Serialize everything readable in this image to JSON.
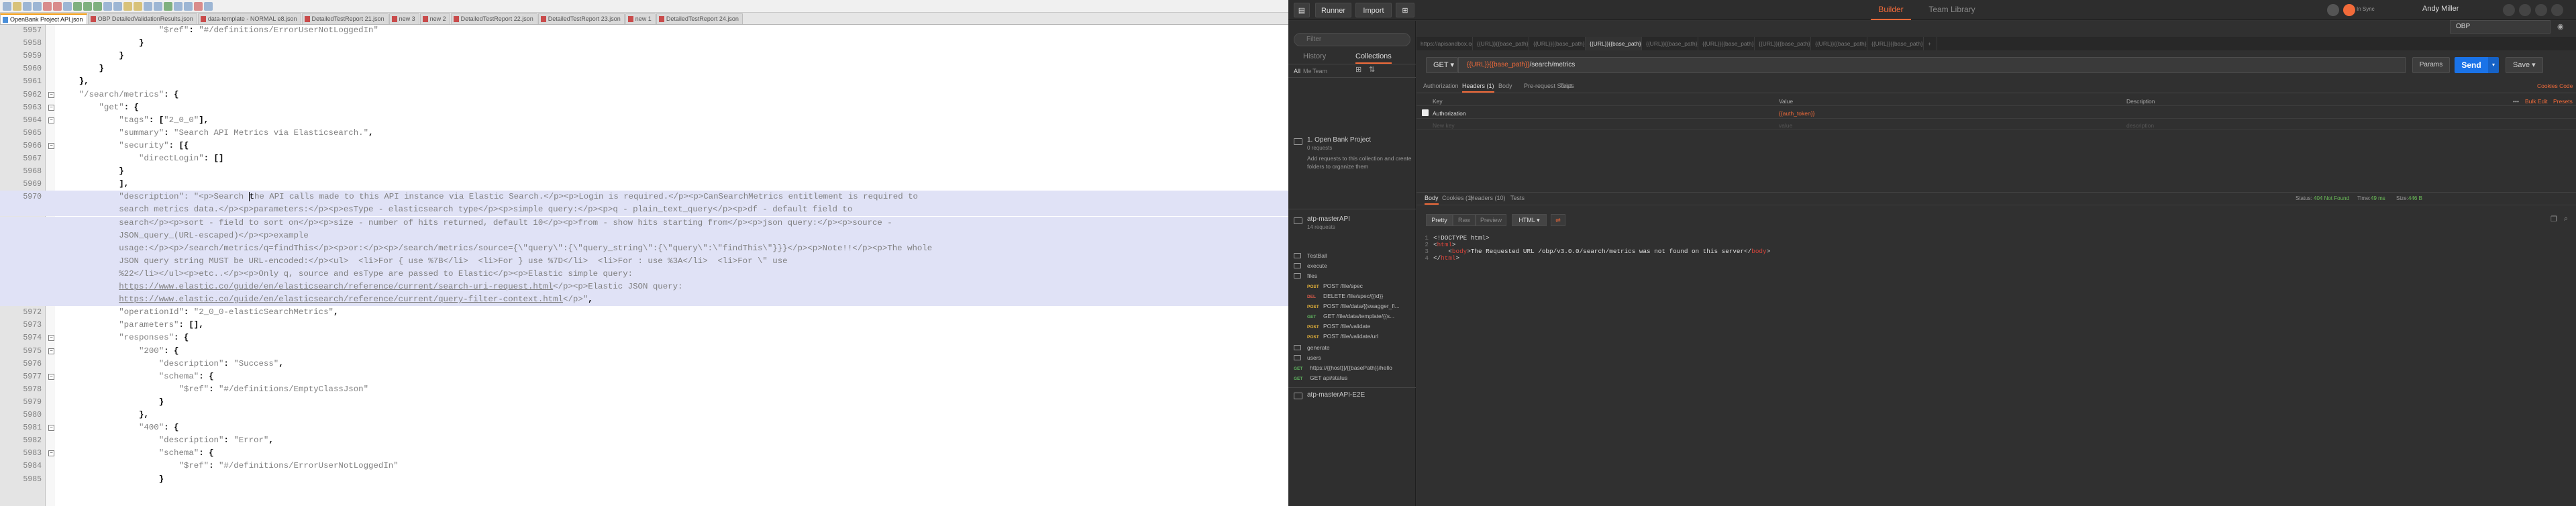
{
  "notepad": {
    "tabs": [
      "OpenBank Project API.json",
      "OBP DetailedValidationResults.json",
      "data-template - NORMAL e8.json",
      "DetailedTestReport 21.json",
      "new 3",
      "new 2",
      "DetailedTestReport 22.json",
      "DetailedTestReport 23.json",
      "new 1",
      "DetailedTestReport 24.json"
    ],
    "lines": [
      {
        "n": "5957",
        "t": [
          {
            "c": "",
            "v": "                    "
          },
          {
            "c": "s",
            "v": "\"$ref\""
          },
          {
            "c": "p",
            "v": ": "
          },
          {
            "c": "s",
            "v": "\"#/definitions/ErrorUserNotLoggedIn\""
          }
        ]
      },
      {
        "n": "5958",
        "t": [
          {
            "c": "p",
            "v": "                }"
          }
        ]
      },
      {
        "n": "5959",
        "t": [
          {
            "c": "p",
            "v": "            }"
          }
        ]
      },
      {
        "n": "5960",
        "t": [
          {
            "c": "p",
            "v": "        }"
          }
        ]
      },
      {
        "n": "5961",
        "t": [
          {
            "c": "p",
            "v": "    },"
          }
        ]
      },
      {
        "n": "5962",
        "fold": "-",
        "t": [
          {
            "c": "",
            "v": "    "
          },
          {
            "c": "s",
            "v": "\"/search/metrics\""
          },
          {
            "c": "p",
            "v": ": {"
          }
        ]
      },
      {
        "n": "5963",
        "fold": "-",
        "t": [
          {
            "c": "",
            "v": "        "
          },
          {
            "c": "s",
            "v": "\"get\""
          },
          {
            "c": "p",
            "v": ": {"
          }
        ]
      },
      {
        "n": "5964",
        "fold": "-",
        "t": [
          {
            "c": "",
            "v": "            "
          },
          {
            "c": "s",
            "v": "\"tags\""
          },
          {
            "c": "p",
            "v": ": ["
          },
          {
            "c": "s",
            "v": "\"2_0_0\""
          },
          {
            "c": "p",
            "v": "],"
          }
        ]
      },
      {
        "n": "5965",
        "t": [
          {
            "c": "",
            "v": "            "
          },
          {
            "c": "s",
            "v": "\"summary\""
          },
          {
            "c": "p",
            "v": ": "
          },
          {
            "c": "s",
            "v": "\"Search API Metrics via Elasticsearch.\""
          },
          {
            "c": "p",
            "v": ","
          }
        ]
      },
      {
        "n": "5966",
        "fold": "-",
        "t": [
          {
            "c": "",
            "v": "            "
          },
          {
            "c": "s",
            "v": "\"security\""
          },
          {
            "c": "p",
            "v": ": [{"
          }
        ]
      },
      {
        "n": "5967",
        "t": [
          {
            "c": "",
            "v": "                "
          },
          {
            "c": "s",
            "v": "\"directLogin\""
          },
          {
            "c": "p",
            "v": ": []"
          }
        ]
      },
      {
        "n": "5968",
        "t": [
          {
            "c": "p",
            "v": "            }"
          }
        ]
      },
      {
        "n": "5969",
        "t": [
          {
            "c": "p",
            "v": "            ],"
          }
        ]
      },
      {
        "n": "5970",
        "sel": true,
        "t": [
          {
            "c": "",
            "v": "            "
          },
          {
            "c": "s",
            "v": "\"description\": \"<p>Search "
          },
          {
            "c": "caret",
            "v": "t"
          },
          {
            "c": "s",
            "v": "he API calls made to this API instance via Elastic Search.</p><p>Login is required.</p><p>CanSearchMetrics entitlement is required to"
          }
        ]
      },
      {
        "n": "",
        "sel": true,
        "t": [
          {
            "c": "s",
            "v": "            search metrics data.</p><p>parameters:</p><p>esType - elasticsearch type</p><p>simple query:</p><p>q - plain_text_query</p><p>df - default field to"
          }
        ]
      },
      {
        "n": "",
        "sel": true,
        "t": [
          {
            "c": "s",
            "v": "            search</p><p>sort - field to sort on</p><p>size - number of hits returned, default 10</p><p>from - show hits starting from</p><p>json query:</p><p>source -"
          }
        ]
      },
      {
        "n": "",
        "sel": true,
        "t": [
          {
            "c": "s",
            "v": "            JSON_query_(URL-escaped)</p><p>example"
          }
        ]
      },
      {
        "n": "",
        "sel": true,
        "t": [
          {
            "c": "s",
            "v": "            usage:</p><p>/search/metrics/q=findThis</p><p>or:</p><p>/search/metrics/source={\\\"query\\\":{\\\"query_string\\\":{\\\"query\\\":\\\"findThis\\\"}}}</p><p>Note!!</p><p>The whole"
          }
        ]
      },
      {
        "n": "",
        "sel": true,
        "t": [
          {
            "c": "s",
            "v": "            JSON query string MUST be URL-encoded:</p><ul>  <li>For { use %7B</li>  <li>For } use %7D</li>  <li>For : use %3A</li>  <li>For \\\" use"
          }
        ]
      },
      {
        "n": "",
        "sel": true,
        "t": [
          {
            "c": "s",
            "v": "            %22</li></ul><p>etc..</p><p>Only q, source and esType are passed to Elastic</p><p>Elastic simple query:"
          }
        ]
      },
      {
        "n": "",
        "sel": true,
        "t": [
          {
            "c": "",
            "v": "            "
          },
          {
            "c": "u",
            "v": "https://www.elastic.co/guide/en/elasticsearch/reference/current/search-uri-request.html"
          },
          {
            "c": "s",
            "v": "</p><p>Elastic JSON query:"
          }
        ]
      },
      {
        "n": "",
        "sel": true,
        "t": [
          {
            "c": "",
            "v": "            "
          },
          {
            "c": "u",
            "v": "https://www.elastic.co/guide/en/elasticsearch/reference/current/query-filter-context.html"
          },
          {
            "c": "s",
            "v": "</p>\""
          },
          {
            "c": "p",
            "v": ","
          }
        ]
      },
      {
        "n": "5972",
        "t": [
          {
            "c": "",
            "v": "            "
          },
          {
            "c": "s",
            "v": "\"operationId\""
          },
          {
            "c": "p",
            "v": ": "
          },
          {
            "c": "s",
            "v": "\"2_0_0-elasticSearchMetrics\""
          },
          {
            "c": "p",
            "v": ","
          }
        ]
      },
      {
        "n": "5973",
        "t": [
          {
            "c": "",
            "v": "            "
          },
          {
            "c": "s",
            "v": "\"parameters\""
          },
          {
            "c": "p",
            "v": ": [],"
          }
        ]
      },
      {
        "n": "5974",
        "fold": "-",
        "t": [
          {
            "c": "",
            "v": "            "
          },
          {
            "c": "s",
            "v": "\"responses\""
          },
          {
            "c": "p",
            "v": ": {"
          }
        ]
      },
      {
        "n": "5975",
        "fold": "-",
        "t": [
          {
            "c": "",
            "v": "                "
          },
          {
            "c": "s",
            "v": "\"200\""
          },
          {
            "c": "p",
            "v": ": {"
          }
        ]
      },
      {
        "n": "5976",
        "t": [
          {
            "c": "",
            "v": "                    "
          },
          {
            "c": "s",
            "v": "\"description\""
          },
          {
            "c": "p",
            "v": ": "
          },
          {
            "c": "s",
            "v": "\"Success\""
          },
          {
            "c": "p",
            "v": ","
          }
        ]
      },
      {
        "n": "5977",
        "fold": "-",
        "t": [
          {
            "c": "",
            "v": "                    "
          },
          {
            "c": "s",
            "v": "\"schema\""
          },
          {
            "c": "p",
            "v": ": {"
          }
        ]
      },
      {
        "n": "5978",
        "t": [
          {
            "c": "",
            "v": "                        "
          },
          {
            "c": "s",
            "v": "\"$ref\""
          },
          {
            "c": "p",
            "v": ": "
          },
          {
            "c": "s",
            "v": "\"#/definitions/EmptyClassJson\""
          }
        ]
      },
      {
        "n": "5979",
        "t": [
          {
            "c": "p",
            "v": "                    }"
          }
        ]
      },
      {
        "n": "5980",
        "t": [
          {
            "c": "p",
            "v": "                },"
          }
        ]
      },
      {
        "n": "5981",
        "fold": "-",
        "t": [
          {
            "c": "",
            "v": "                "
          },
          {
            "c": "s",
            "v": "\"400\""
          },
          {
            "c": "p",
            "v": ": {"
          }
        ]
      },
      {
        "n": "5982",
        "t": [
          {
            "c": "",
            "v": "                    "
          },
          {
            "c": "s",
            "v": "\"description\""
          },
          {
            "c": "p",
            "v": ": "
          },
          {
            "c": "s",
            "v": "\"Error\""
          },
          {
            "c": "p",
            "v": ","
          }
        ]
      },
      {
        "n": "5983",
        "fold": "-",
        "t": [
          {
            "c": "",
            "v": "                    "
          },
          {
            "c": "s",
            "v": "\"schema\""
          },
          {
            "c": "p",
            "v": ": {"
          }
        ]
      },
      {
        "n": "5984",
        "t": [
          {
            "c": "",
            "v": "                        "
          },
          {
            "c": "s",
            "v": "\"$ref\""
          },
          {
            "c": "p",
            "v": ": "
          },
          {
            "c": "s",
            "v": "\"#/definitions/ErrorUserNotLoggedIn\""
          }
        ]
      },
      {
        "n": "5985",
        "t": [
          {
            "c": "p",
            "v": "                    }"
          }
        ]
      }
    ]
  },
  "postman": {
    "toolbar": {
      "runner": "Runner",
      "import": "Import",
      "builder": "Builder",
      "team_library": "Team Library",
      "user": "Andy Miller"
    },
    "sidebar": {
      "filter_placeholder": "Filter",
      "history": "History",
      "collections": "Collections",
      "sub_all": "All",
      "sub_me": "Me",
      "sub_team": "Team",
      "c1_title": "1. Open Bank Project",
      "c1_count": "0 requests",
      "c1_hint": "Add requests to this collection and create folders to organize them",
      "c2_title": "atp-masterAPI",
      "c2_count": "14 requests",
      "folders": [
        "TestBall",
        "execute",
        "files"
      ],
      "requests": [
        {
          "m": "POST",
          "cls": "post",
          "t": "POST /file/spec"
        },
        {
          "m": "DEL",
          "cls": "del",
          "t": "DELETE /file/spec/{{id}}"
        },
        {
          "m": "POST",
          "cls": "post",
          "t": "POST /file/data/{{swagger_fi..."
        },
        {
          "m": "GET",
          "cls": "get",
          "t": "GET /file/data/template/{{s..."
        },
        {
          "m": "POST",
          "cls": "post",
          "t": "POST /file/validate"
        },
        {
          "m": "POST",
          "cls": "post",
          "t": "POST /file/validate/url"
        }
      ],
      "folders2": [
        "generate",
        "users"
      ],
      "requests2": [
        {
          "m": "GET",
          "cls": "get",
          "t": "https://{{host}}/{{basePath}}/hello"
        },
        {
          "m": "GET",
          "cls": "get",
          "t": "GET api/status"
        }
      ],
      "c3_title": "atp-masterAPI-E2E"
    },
    "request_tabs": [
      "https://apisandbox.openba",
      "{{URL}}{{base_path}}/accou",
      "{{URL}}{{base_path}}/my/ac",
      "{{URL}}{{base_path}}/ ×",
      "{{URL}}{{base_path}}/custo",
      "{{URL}}{{base_path}}/custo",
      "{{URL}}{{base_path}}/banks",
      "{{URL}}{{base_path}}/banks",
      "{{URL}}{{base_path}}/banks"
    ],
    "environment": "OBP",
    "method": "GET",
    "url_var": "{{URL}}{{base_path}}",
    "url_path": "/search/metrics",
    "params_label": "Params",
    "send_label": "Send",
    "save_label": "Save",
    "req_subtabs": [
      "Authorization",
      "Headers (1)",
      "Body",
      "Pre-request Script",
      "Tests"
    ],
    "cookies_code": "Cookies  Code",
    "headers_table": {
      "cols": [
        "Key",
        "Value",
        "Description"
      ],
      "bulk_edit": "Bulk Edit",
      "presets": "Presets",
      "row_key": "Authorization",
      "row_value": "{{auth_token}}",
      "new_key": "New key",
      "new_value": "value",
      "new_desc": "description"
    },
    "response": {
      "tabs": [
        "Body",
        "Cookies (1)",
        "Headers (10)",
        "Tests"
      ],
      "status_label": "Status:",
      "status": "404 Not Found",
      "time_label": "Time:",
      "time": "49 ms",
      "size_label": "Size:",
      "size": "446 B",
      "view_buttons": [
        "Pretty",
        "Raw",
        "Preview"
      ],
      "format": "HTML",
      "lines": [
        {
          "n": "1",
          "parts": [
            {
              "c": "",
              "v": "<!DOCTYPE html>"
            }
          ]
        },
        {
          "n": "2",
          "parts": [
            {
              "c": "",
              "v": "<"
            },
            {
              "c": "tg",
              "v": "html"
            },
            {
              "c": "",
              "v": ">"
            }
          ]
        },
        {
          "n": "3",
          "parts": [
            {
              "c": "",
              "v": "    <"
            },
            {
              "c": "tg",
              "v": "body"
            },
            {
              "c": "",
              "v": ">The Requested URL /obp/v3.0.0/search/metrics was not found on this server</"
            },
            {
              "c": "tg",
              "v": "body"
            },
            {
              "c": "",
              "v": ">"
            }
          ]
        },
        {
          "n": "4",
          "parts": [
            {
              "c": "",
              "v": "</"
            },
            {
              "c": "tg",
              "v": "html"
            },
            {
              "c": "",
              "v": ">"
            }
          ]
        }
      ]
    }
  }
}
